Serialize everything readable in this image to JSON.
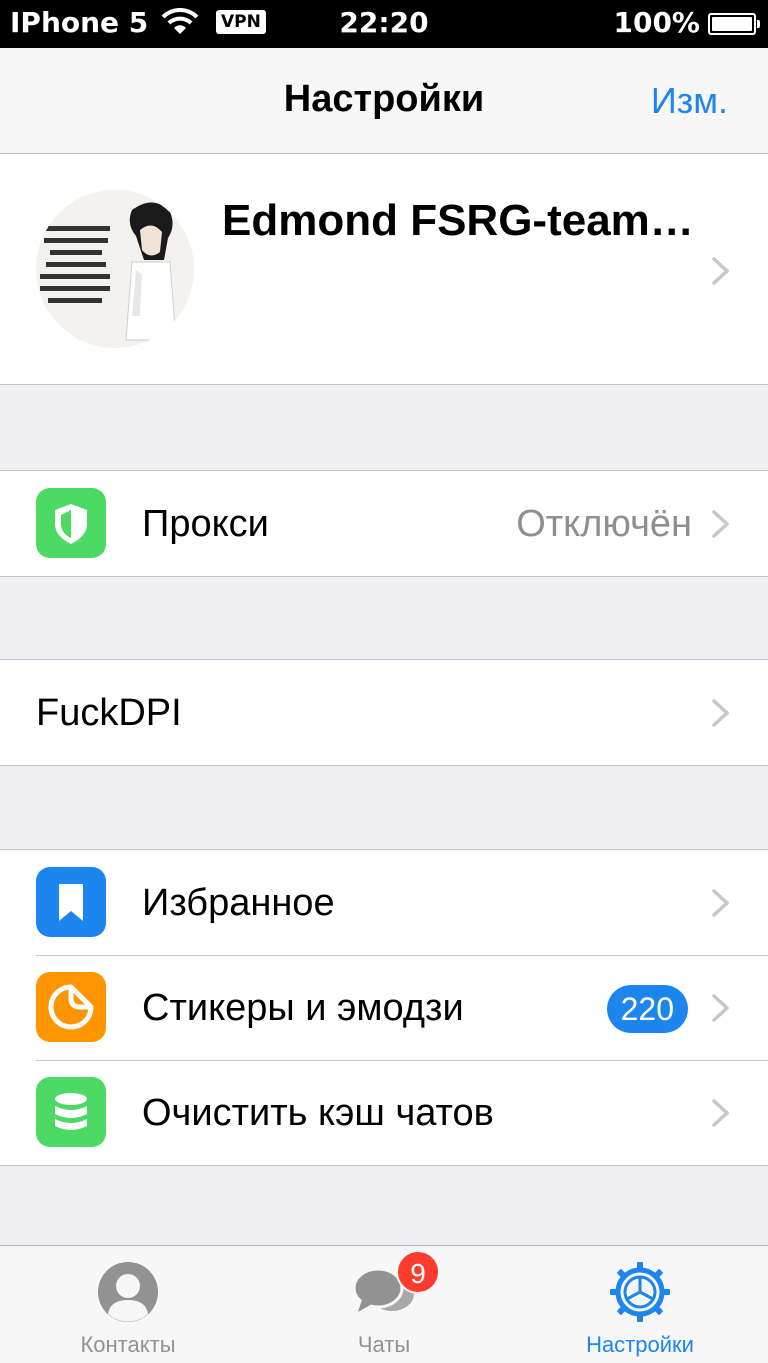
{
  "status_bar": {
    "carrier": "IPhone 5",
    "vpn": "VPN",
    "time": "22:20",
    "battery": "100%"
  },
  "nav": {
    "title": "Настройки",
    "edit": "Изм."
  },
  "profile": {
    "name": "Edmond FSRG-team…"
  },
  "groups": [
    {
      "rows": [
        {
          "icon": "shield-icon",
          "color": "#4cd964",
          "label": "Прокси",
          "value": "Отключён"
        }
      ]
    },
    {
      "rows": [
        {
          "label": "FuckDPI"
        }
      ]
    },
    {
      "rows": [
        {
          "icon": "bookmark-icon",
          "color": "#1c86ee",
          "label": "Избранное"
        },
        {
          "icon": "sticker-icon",
          "color": "#ff9500",
          "label": "Стикеры и эмодзи",
          "badge": "220"
        },
        {
          "icon": "database-icon",
          "color": "#4cd964",
          "label": "Очистить кэш чатов"
        }
      ]
    }
  ],
  "tabs": [
    {
      "icon": "person-icon",
      "label": "Контакты"
    },
    {
      "icon": "chat-bubbles-icon",
      "label": "Чаты",
      "badge": "9"
    },
    {
      "icon": "settings-gear-icon",
      "label": "Настройки",
      "active": true
    }
  ],
  "colors": {
    "accent": "#1c86ee",
    "green": "#4cd964",
    "orange": "#ff9500",
    "badge_red": "#ff3b30"
  }
}
